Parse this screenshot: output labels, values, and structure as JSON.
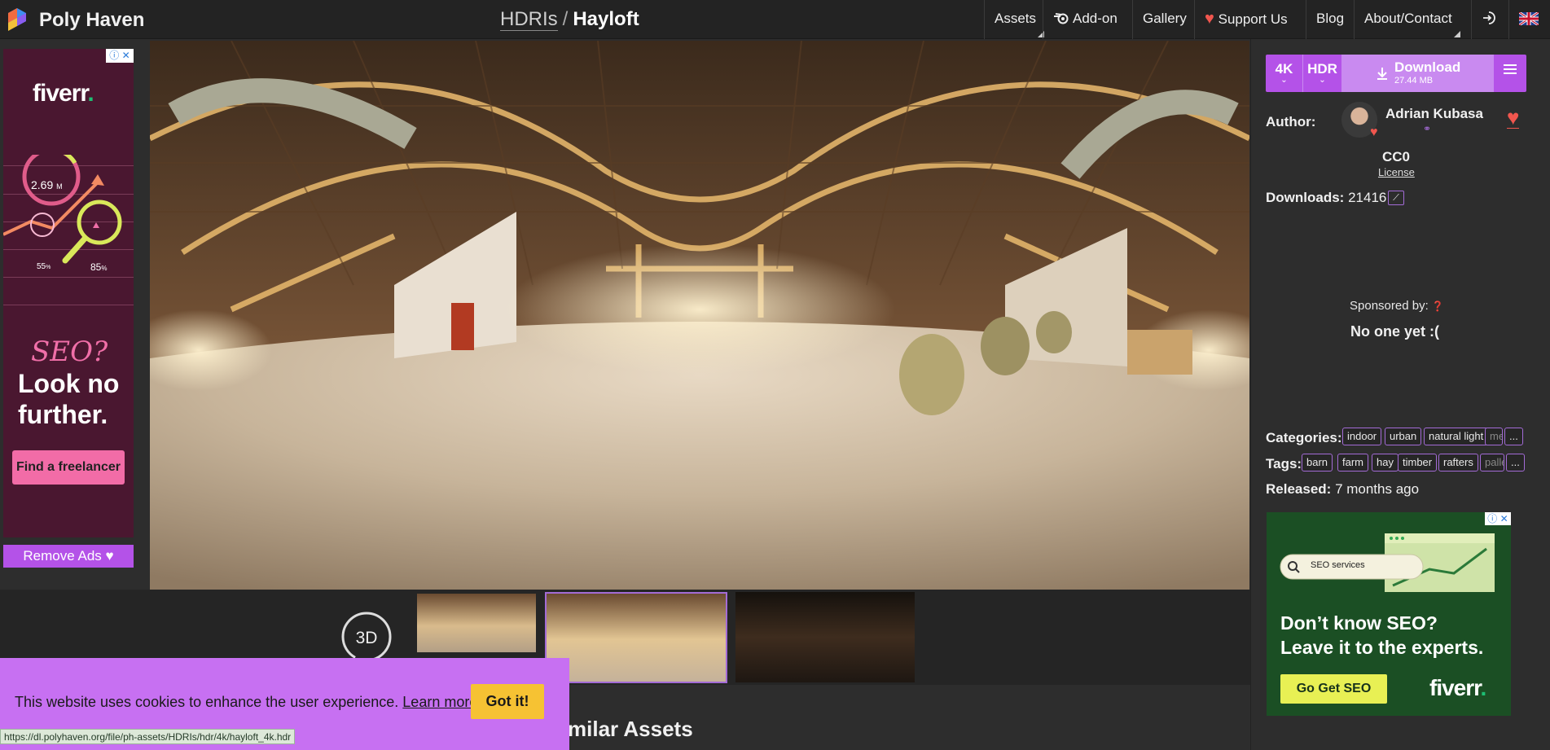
{
  "nav": {
    "brand": "Poly Haven",
    "breadcrumb_parent": "HDRIs",
    "breadcrumb_sep": "/",
    "breadcrumb_current": "Hayloft",
    "items": [
      "Assets",
      "Add-on",
      "Gallery",
      "Support Us",
      "Blog",
      "About/Contact"
    ]
  },
  "left_ad": {
    "brand": "fiverr",
    "stat_big": "2.69",
    "stat_big_unit": "M",
    "stat_small": "55",
    "stat_small_unit": "%",
    "stat_mid": "85",
    "stat_mid_unit": "%",
    "headline_italic": "SEO?",
    "headline_line1": "Look no",
    "headline_line2": "further.",
    "cta": "Find a freelancer"
  },
  "remove_ads": "Remove Ads",
  "download": {
    "resolution": "4K",
    "format": "HDR",
    "label": "Download",
    "size": "27.44 MB"
  },
  "author": {
    "label": "Author:",
    "name": "Adrian Kubasa",
    "license": "CC0",
    "license_link": "License"
  },
  "downloads": {
    "label": "Downloads:",
    "count": "21416"
  },
  "sponsor": {
    "label": "Sponsored by:",
    "value": "No one yet :("
  },
  "categories": {
    "label": "Categories:",
    "items": [
      "indoor",
      "urban",
      "natural light",
      "me",
      "..."
    ]
  },
  "tags": {
    "label": "Tags:",
    "items": [
      "barn",
      "farm",
      "hay",
      "timber",
      "rafters",
      "pallet",
      "..."
    ]
  },
  "released": {
    "label": "Released:",
    "value": "7 months ago"
  },
  "right_ad": {
    "search_text": "SEO services",
    "headline_line1": "Don’t know SEO?",
    "headline_line2": "Leave it to the experts.",
    "cta": "Go Get SEO",
    "brand": "fiverr"
  },
  "viewer": {
    "button_3d": "3D"
  },
  "cookie": {
    "text": "This website uses cookies to enhance the user experience.",
    "link": "Learn more.",
    "button": "Got it!"
  },
  "similar_heading": "milar Assets",
  "status_url": "https://dl.polyhaven.org/file/ph-assets/HDRIs/hdr/4k/hayloft_4k.hdr",
  "colors": {
    "accent": "#b452e8",
    "heart": "#f1564e",
    "cookie_bg": "#c770f2",
    "got_it": "#f6c233"
  }
}
